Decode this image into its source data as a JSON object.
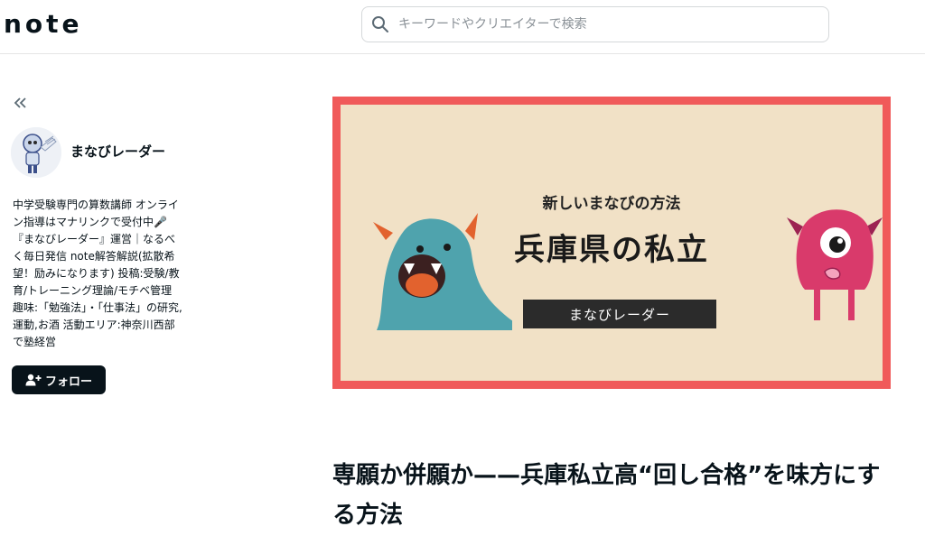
{
  "header": {
    "logo": "note",
    "search_placeholder": "キーワードやクリエイターで検索"
  },
  "sidebar": {
    "collapse_label": "«",
    "creator_name": "まなびレーダー",
    "bio": "中学受験専門の算数講師 オンライン指導はマナリンクで受付中🎤\n『まなびレーダー』運営｜なるべく毎日発信 note解答解説(拡散希望！励みになります) 投稿:受験/教育/トレーニング理論/モチベ管理 趣味:「勉強法」・「仕事法」の研究,運動,お酒 活動エリア:神奈川西部で塾経営",
    "follow_label": "フォロー"
  },
  "hero": {
    "subtitle": "新しいまなびの方法",
    "title": "兵庫県の私立",
    "band_label": "まなびレーダー",
    "colors": {
      "border": "#f05a5a",
      "background": "#f1e1c6",
      "band": "#2b2b2b",
      "monster_left": "#4fa3ad",
      "monster_right": "#d93a6b"
    }
  },
  "article": {
    "title": "専願か併願か——兵庫私立高“回し合格”を味方にする方法"
  }
}
